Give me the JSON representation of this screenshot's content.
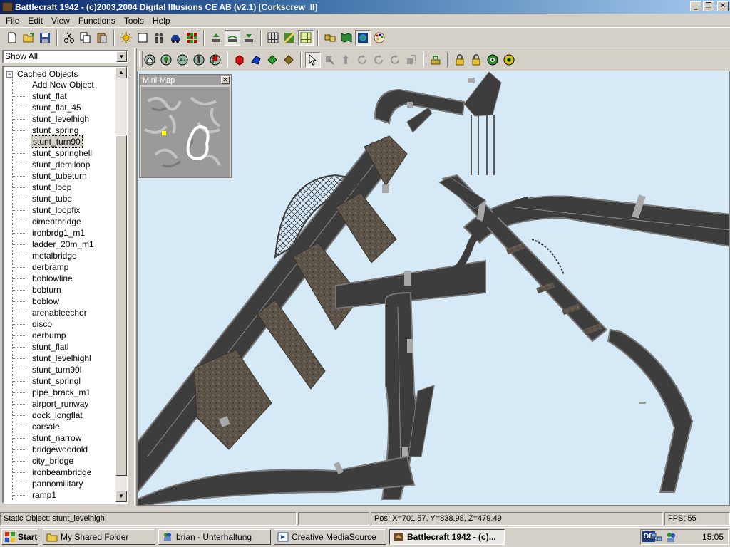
{
  "window": {
    "title": "Battlecraft 1942 - (c)2003,2004 Digital Illusions CE AB (v2.1) [Corkscrew_II]",
    "controls": [
      "_",
      "❐",
      "✕"
    ]
  },
  "menu": [
    "File",
    "Edit",
    "View",
    "Functions",
    "Tools",
    "Help"
  ],
  "left_panel": {
    "filter": "Show All",
    "tree_root": "Cached Objects",
    "selected": "stunt_turn90",
    "items": [
      "Add New Object",
      "stunt_flat",
      "stunt_flat_45",
      "stunt_levelhigh",
      "stunt_spring",
      "stunt_turn90",
      "stunt_springhell",
      "stunt_demiloop",
      "stunt_tubeturn",
      "stunt_loop",
      "stunt_tube",
      "stunt_loopfix",
      "cimentbridge",
      "ironbrdg1_m1",
      "ladder_20m_m1",
      "metalbridge",
      "derbramp",
      "boblowline",
      "bobturn",
      "boblow",
      "arenableecher",
      "disco",
      "derbump",
      "stunt_flatl",
      "stunt_levelhighl",
      "stunt_turn90l",
      "stunt_springl",
      "pipe_brack_m1",
      "airport_runway",
      "dock_longflat",
      "carsale",
      "stunt_narrow",
      "bridgewoodold",
      "city_bridge",
      "ironbeambridge",
      "pannomilitary",
      "ramp1"
    ]
  },
  "minimap": {
    "title": "Mini-Map"
  },
  "status": {
    "object": "Static Object: stunt_levelhigh",
    "pos": "Pos: X=701.57, Y=838.98, Z=479.49",
    "fps": "FPS: 55"
  },
  "taskbar": {
    "start": "Start",
    "tasks": [
      {
        "label": "My Shared Folder",
        "icon": "folder-icon",
        "active": false
      },
      {
        "label": "brian - Unterhaltung",
        "icon": "messenger-icon",
        "active": false
      },
      {
        "label": "Creative MediaSource",
        "icon": "media-icon",
        "active": false
      },
      {
        "label": "Battlecraft 1942 - (c)...",
        "icon": "battlecraft-icon",
        "active": true
      }
    ],
    "language": "DE",
    "tray_chevron": "«",
    "clock": "15:05"
  },
  "colors": {
    "title_gradient_start": "#0a246a",
    "title_gradient_end": "#a6caf0",
    "viewport_sky": "#d6e9f7",
    "track_asphalt": "#3d3d3d",
    "track_edge": "#7a7a7a",
    "support_mud": "#5e554a"
  }
}
